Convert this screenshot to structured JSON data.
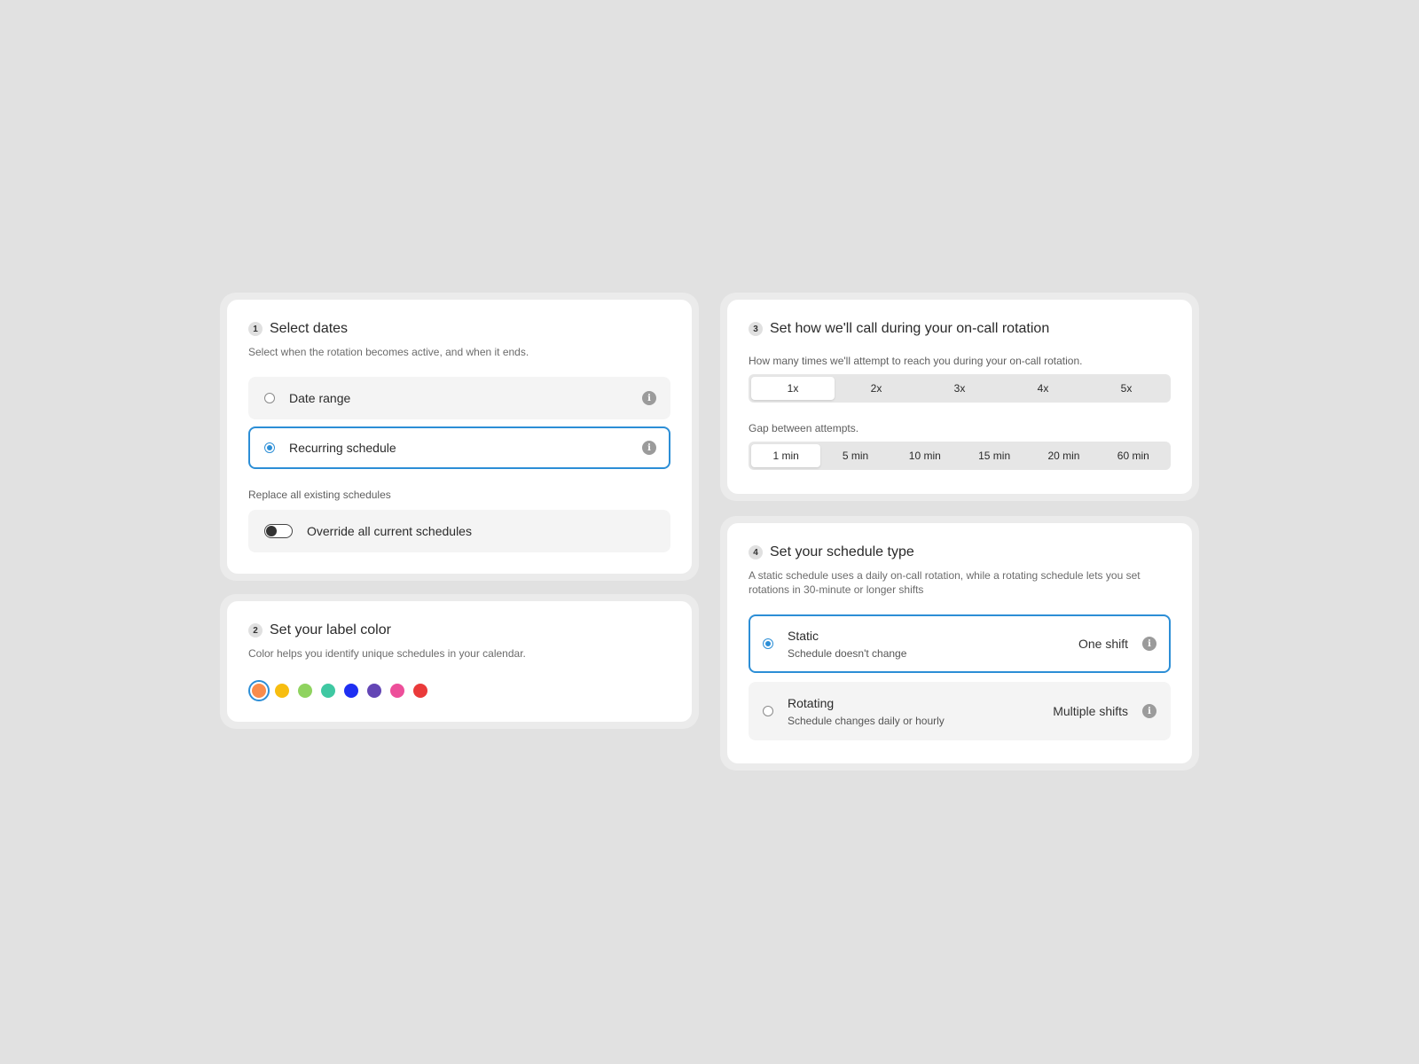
{
  "select_dates": {
    "step": "1",
    "title": "Select dates",
    "subtitle": "Select when the rotation becomes active, and when it ends.",
    "options": [
      {
        "label": "Date range",
        "selected": false
      },
      {
        "label": "Recurring schedule",
        "selected": true
      }
    ],
    "replace_label": "Replace all existing schedules",
    "override_label": "Override all current schedules",
    "override_enabled": false
  },
  "label_color": {
    "step": "2",
    "title": "Set your label color",
    "subtitle": "Color helps you identify unique schedules in your calendar.",
    "colors": [
      "#f98c4b",
      "#f7bd10",
      "#8fd35f",
      "#3fc8a2",
      "#1e2ff2",
      "#6346b5",
      "#ed4f9a",
      "#ea3a3a"
    ],
    "selected_index": 0
  },
  "call_settings": {
    "step": "3",
    "title": "Set how we'll call during your on-call rotation",
    "attempts_label": "How many times we'll attempt to reach you during your on-call rotation.",
    "attempts": [
      "1x",
      "2x",
      "3x",
      "4x",
      "5x"
    ],
    "attempts_selected": "1x",
    "gap_label": "Gap between attempts.",
    "gaps": [
      "1 min",
      "5 min",
      "10 min",
      "15 min",
      "20 min",
      "60 min"
    ],
    "gap_selected": "1 min"
  },
  "schedule_type": {
    "step": "4",
    "title": "Set your schedule type",
    "subtitle": "A static schedule uses a daily on-call rotation, while a rotating schedule lets you set rotations in 30-minute or longer shifts",
    "options": [
      {
        "title": "Static",
        "subtitle": "Schedule doesn't change",
        "right": "One shift",
        "selected": true
      },
      {
        "title": "Rotating",
        "subtitle": "Schedule changes daily or hourly",
        "right": "Multiple shifts",
        "selected": false
      }
    ]
  },
  "accent_color": "#2c8ed6"
}
